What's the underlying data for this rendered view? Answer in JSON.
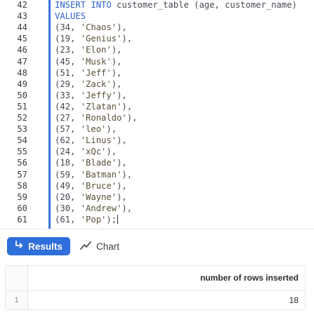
{
  "editor": {
    "lines": [
      {
        "num": "42",
        "segments": [
          {
            "t": "INSERT INTO",
            "c": "kw"
          },
          {
            "t": " customer_table (age, customer_name)",
            "c": "plain"
          }
        ]
      },
      {
        "num": "43",
        "segments": [
          {
            "t": "VALUES",
            "c": "kw"
          }
        ]
      },
      {
        "num": "44",
        "segments": [
          {
            "t": "(34, ",
            "c": "plain"
          },
          {
            "t": "'Chaos'",
            "c": "str"
          },
          {
            "t": "),",
            "c": "plain"
          }
        ]
      },
      {
        "num": "45",
        "segments": [
          {
            "t": "(19, ",
            "c": "plain"
          },
          {
            "t": "'Genius'",
            "c": "str"
          },
          {
            "t": "),",
            "c": "plain"
          }
        ]
      },
      {
        "num": "46",
        "segments": [
          {
            "t": "(23, ",
            "c": "plain"
          },
          {
            "t": "'Elon'",
            "c": "str"
          },
          {
            "t": "),",
            "c": "plain"
          }
        ]
      },
      {
        "num": "47",
        "segments": [
          {
            "t": "(45, ",
            "c": "plain"
          },
          {
            "t": "'Musk'",
            "c": "str"
          },
          {
            "t": "),",
            "c": "plain"
          }
        ]
      },
      {
        "num": "48",
        "segments": [
          {
            "t": "(51, ",
            "c": "plain"
          },
          {
            "t": "'Jeff'",
            "c": "str"
          },
          {
            "t": "),",
            "c": "plain"
          }
        ]
      },
      {
        "num": "49",
        "segments": [
          {
            "t": "(29, ",
            "c": "plain"
          },
          {
            "t": "'Zack'",
            "c": "str"
          },
          {
            "t": "),",
            "c": "plain"
          }
        ]
      },
      {
        "num": "50",
        "segments": [
          {
            "t": "(33, ",
            "c": "plain"
          },
          {
            "t": "'Jeffy'",
            "c": "str"
          },
          {
            "t": "),",
            "c": "plain"
          }
        ]
      },
      {
        "num": "51",
        "segments": [
          {
            "t": "(42, ",
            "c": "plain"
          },
          {
            "t": "'Zlatan'",
            "c": "str"
          },
          {
            "t": "),",
            "c": "plain"
          }
        ]
      },
      {
        "num": "52",
        "segments": [
          {
            "t": "(27, ",
            "c": "plain"
          },
          {
            "t": "'Ronaldo'",
            "c": "str"
          },
          {
            "t": "),",
            "c": "plain"
          }
        ]
      },
      {
        "num": "53",
        "segments": [
          {
            "t": "(57, ",
            "c": "plain"
          },
          {
            "t": "'leo'",
            "c": "str"
          },
          {
            "t": "),",
            "c": "plain"
          }
        ]
      },
      {
        "num": "54",
        "segments": [
          {
            "t": "(62, ",
            "c": "plain"
          },
          {
            "t": "'Linus'",
            "c": "str"
          },
          {
            "t": "),",
            "c": "plain"
          }
        ]
      },
      {
        "num": "55",
        "segments": [
          {
            "t": "(24, ",
            "c": "plain"
          },
          {
            "t": "'xQc'",
            "c": "str"
          },
          {
            "t": "),",
            "c": "plain"
          }
        ]
      },
      {
        "num": "56",
        "segments": [
          {
            "t": "(18, ",
            "c": "plain"
          },
          {
            "t": "'Blade'",
            "c": "str"
          },
          {
            "t": "),",
            "c": "plain"
          }
        ]
      },
      {
        "num": "57",
        "segments": [
          {
            "t": "(59, ",
            "c": "plain"
          },
          {
            "t": "'Batman'",
            "c": "str"
          },
          {
            "t": "),",
            "c": "plain"
          }
        ]
      },
      {
        "num": "58",
        "segments": [
          {
            "t": "(49, ",
            "c": "plain"
          },
          {
            "t": "'Bruce'",
            "c": "str"
          },
          {
            "t": "),",
            "c": "plain"
          }
        ]
      },
      {
        "num": "59",
        "segments": [
          {
            "t": "(20, ",
            "c": "plain"
          },
          {
            "t": "'Wayne'",
            "c": "str"
          },
          {
            "t": "),",
            "c": "plain"
          }
        ]
      },
      {
        "num": "60",
        "segments": [
          {
            "t": "(30, ",
            "c": "plain"
          },
          {
            "t": "'Andrew'",
            "c": "str"
          },
          {
            "t": "),",
            "c": "plain"
          }
        ]
      },
      {
        "num": "61",
        "segments": [
          {
            "t": "(61, ",
            "c": "plain"
          },
          {
            "t": "'Pop'",
            "c": "str"
          },
          {
            "t": ");",
            "c": "plain"
          }
        ],
        "cursor": true
      }
    ]
  },
  "tabs": {
    "results_label": "Results",
    "results_icon": "return-arrow-icon",
    "chart_label": "Chart",
    "chart_icon": "line-chart-icon",
    "active": "results",
    "accent_color": "#2f6fdc"
  },
  "result_table": {
    "column_header": "number of rows inserted",
    "rows": [
      {
        "row_number": "1",
        "value": "18"
      }
    ]
  }
}
